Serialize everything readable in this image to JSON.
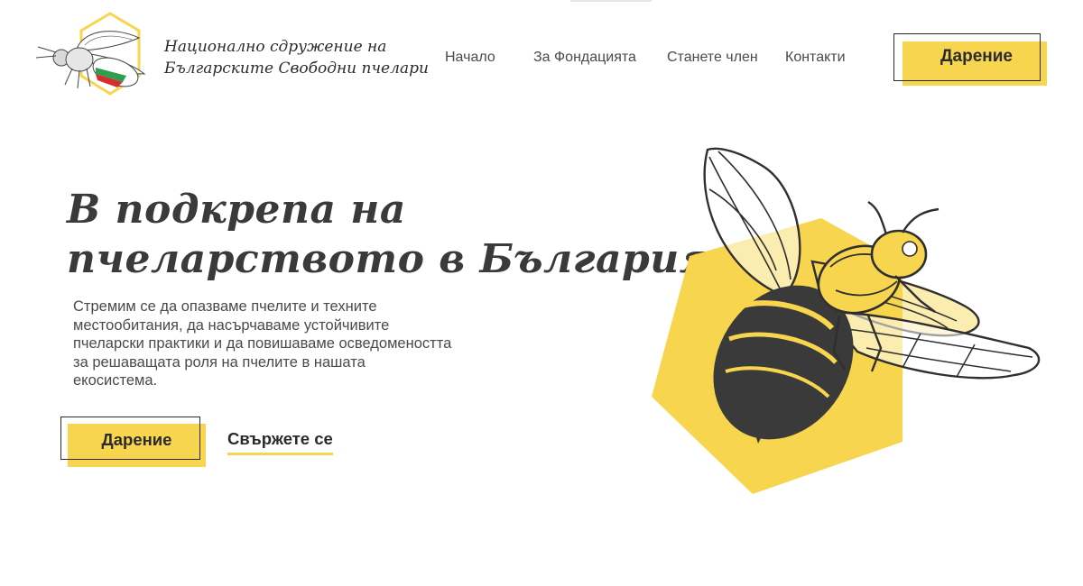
{
  "header": {
    "brand_line1": "Национално сдружение на",
    "brand_line2": "Българските Свободни пчелари",
    "nav": [
      {
        "label": "Начало"
      },
      {
        "label": "За Фондацията"
      },
      {
        "label": "Станете член"
      },
      {
        "label": "Контакти"
      }
    ],
    "donate_label": "Дарение"
  },
  "hero": {
    "title_line1": "В подкрепа на",
    "title_line2": "пчеларството в България",
    "description": "Стремим се да опазваме пчелите и техните местообитания, да насърчаваме устойчивите пчеларски практики и да повишаваме осведомеността за решаващата роля на пчелите в нашата екосистема.",
    "donate_label": "Дарение",
    "contact_label": "Свържете се"
  },
  "colors": {
    "accent": "#f7d54e",
    "text": "#333333",
    "flag_white": "#ffffff",
    "flag_green": "#2e9e4f",
    "flag_red": "#d32f2f"
  },
  "icons": {
    "logo": "bee-hexagon-logo-icon",
    "hero_image": "bee-illustration-icon"
  }
}
